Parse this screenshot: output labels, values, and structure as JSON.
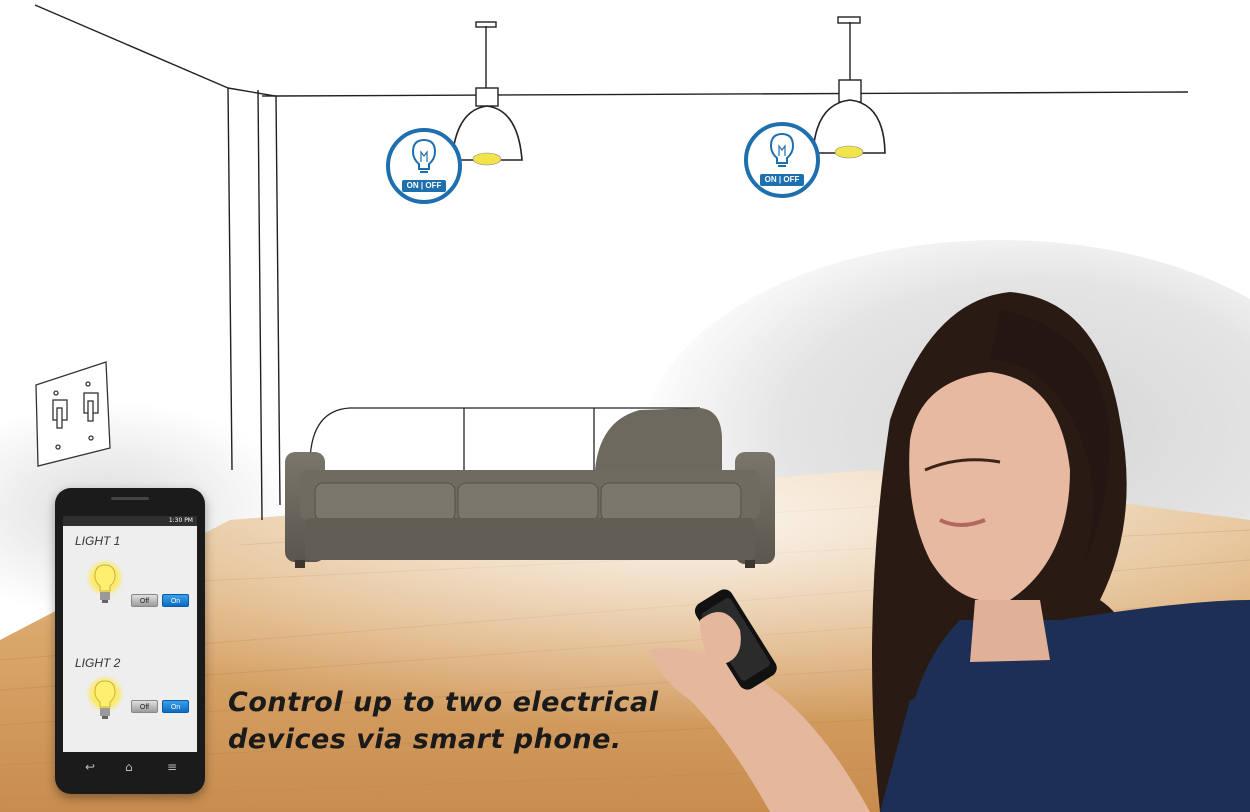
{
  "caption": {
    "line1": "Control up to two electrical",
    "line2": "devices via smart phone."
  },
  "ceiling_badges": [
    {
      "label": "ON | OFF"
    },
    {
      "label": "ON | OFF"
    }
  ],
  "phone": {
    "status_time": "1:30 PM",
    "lights": [
      {
        "label": "LIGHT 1",
        "off_label": "Off",
        "on_label": "On"
      },
      {
        "label": "LIGHT 2",
        "off_label": "Off",
        "on_label": "On"
      }
    ],
    "nav_icons": [
      "back-icon",
      "home-icon",
      "menu-icon"
    ]
  },
  "colors": {
    "accent_blue": "#1e6fae",
    "on_button": "#0c6cc4",
    "bulb_glow": "#ffe84a",
    "floor": "#d9a86a",
    "sofa": "#6a665c"
  }
}
